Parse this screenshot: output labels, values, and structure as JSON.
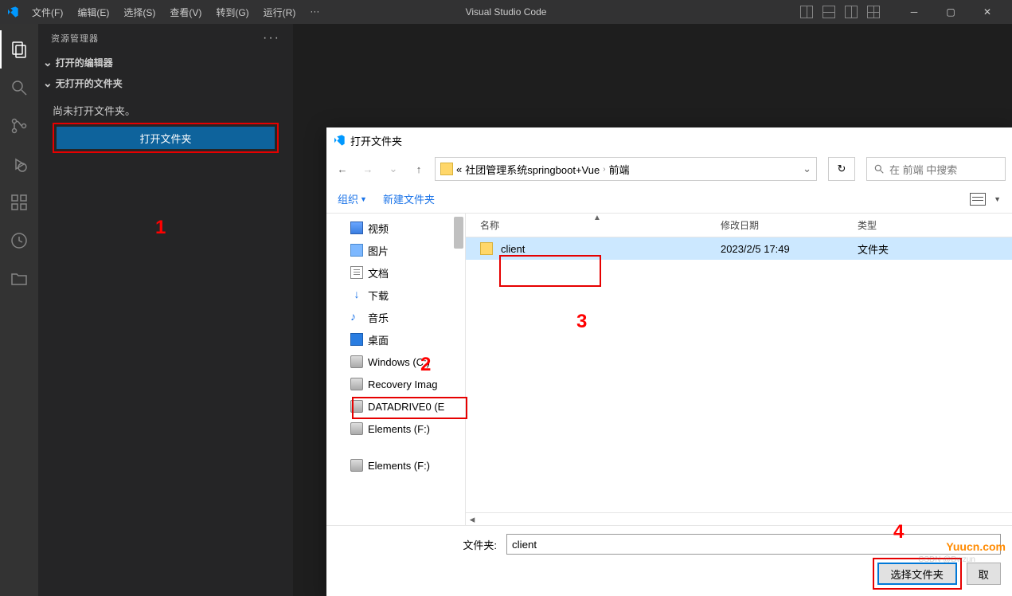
{
  "titlebar": {
    "app_title": "Visual Studio Code",
    "menu": [
      "文件(F)",
      "编辑(E)",
      "选择(S)",
      "查看(V)",
      "转到(G)",
      "运行(R)"
    ],
    "ellipsis": "···"
  },
  "sidebar": {
    "title": "资源管理器",
    "dots": "···",
    "sections": {
      "open_editors": "打开的编辑器",
      "no_folder": "无打开的文件夹"
    },
    "no_folder_msg": "尚未打开文件夹。",
    "open_folder_btn": "打开文件夹"
  },
  "annotations": {
    "a1": "1",
    "a2": "2",
    "a3": "3",
    "a4": "4"
  },
  "dialog": {
    "title": "打开文件夹",
    "breadcrumb": {
      "prefix": "«",
      "seg1": "社团管理系统springboot+Vue",
      "seg2": "前端"
    },
    "refresh": "↻",
    "search_placeholder": "在 前端 中搜索",
    "toolbar": {
      "organize": "组织",
      "new_folder": "新建文件夹"
    },
    "tree": [
      {
        "label": "视频",
        "ico": "ico-video"
      },
      {
        "label": "图片",
        "ico": "ico-pic"
      },
      {
        "label": "文档",
        "ico": "ico-doc"
      },
      {
        "label": "下载",
        "ico": "ico-dl",
        "glyph": "↓"
      },
      {
        "label": "音乐",
        "ico": "ico-music",
        "glyph": "♪"
      },
      {
        "label": "桌面",
        "ico": "ico-desktop"
      },
      {
        "label": "Windows (C:)",
        "ico": "ico-disk"
      },
      {
        "label": "Recovery Imag",
        "ico": "ico-disk",
        "box": true
      },
      {
        "label": "DATADRIVE0 (E",
        "ico": "ico-disk"
      },
      {
        "label": "Elements (F:)",
        "ico": "ico-disk"
      },
      {
        "label": "Elements (F:)",
        "ico": "ico-disk",
        "gap": true
      }
    ],
    "columns": {
      "name": "名称",
      "date": "修改日期",
      "type": "类型"
    },
    "rows": [
      {
        "name": "client",
        "date": "2023/2/5 17:49",
        "type": "文件夹"
      }
    ],
    "footer": {
      "label": "文件夹:",
      "value": "client",
      "select_btn": "选择文件夹",
      "cancel_btn": "取"
    }
  },
  "watermark": "Yuucn.com",
  "watermark2": "CSDN @Dwzun"
}
